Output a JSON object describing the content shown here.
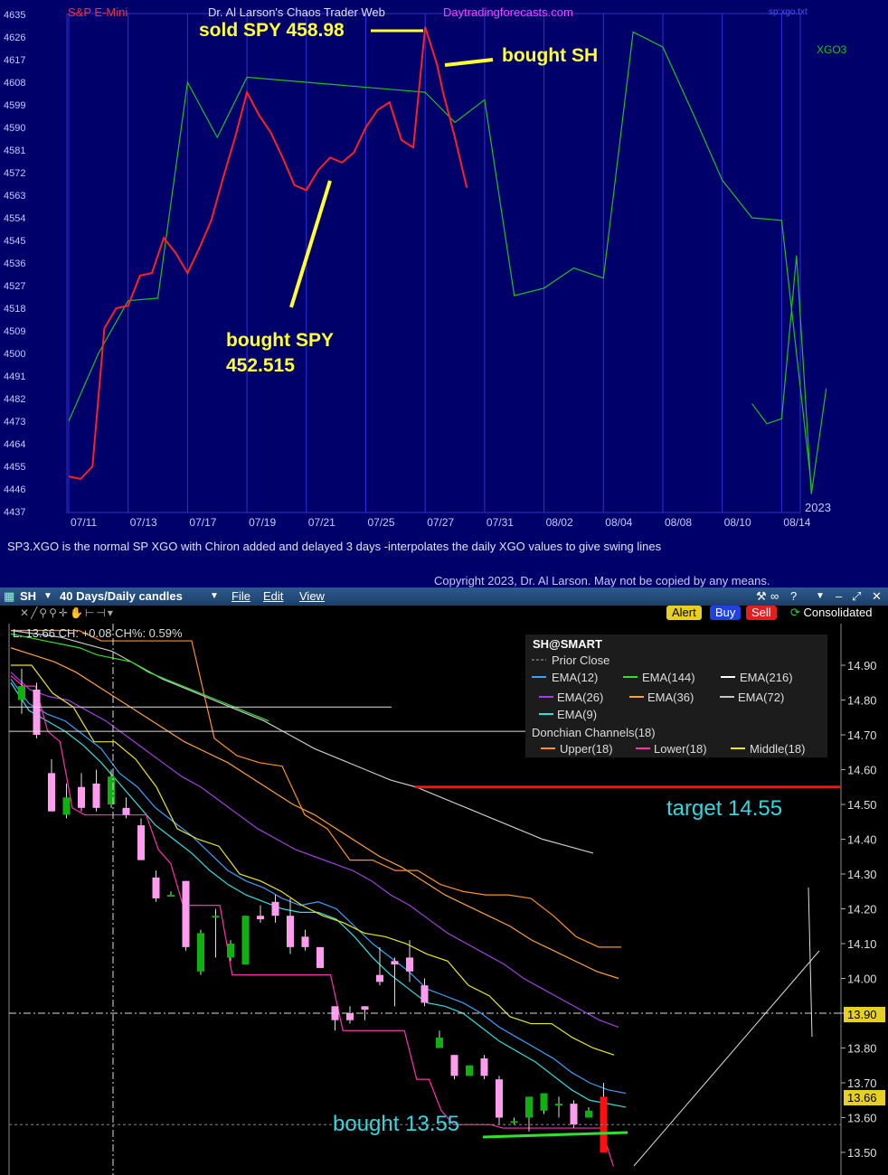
{
  "top_chart": {
    "header": {
      "left": "S&P E-Mini",
      "center": "Dr. Al Larson's Chaos Trader Web",
      "site": "Daytradingforecasts.com",
      "right_small": "sp:xgo.txt",
      "legend": "XGO3",
      "year": "2023"
    },
    "annotations": {
      "sold": "sold SPY 458.98",
      "bought_sh": "bought SH",
      "bought_spy_line1": "bought SPY",
      "bought_spy_line2": "452.515"
    },
    "footer_note": "SP3.XGO is the normal SP XGO with Chiron added and delayed 3 days -interpolates the daily XGO values to give swing lines",
    "copyright": "Copyright 2023, Dr. Al Larson. May not be copied by any means.",
    "colors": {
      "background": "#00006a",
      "grid": "#3030e0",
      "price": "#ff2020",
      "xgo": "#20c020",
      "annotation": "#ffff30"
    },
    "chart_data": {
      "type": "line",
      "ylim": [
        4437,
        4635
      ],
      "y_ticks": [
        "4635",
        "4626",
        "4617",
        "4608",
        "4599",
        "4590",
        "4581",
        "4572",
        "4563",
        "4554",
        "4545",
        "4536",
        "4527",
        "4518",
        "4509",
        "4500",
        "4491",
        "4482",
        "4473",
        "4464",
        "4455",
        "4446",
        "4437"
      ],
      "x_tick_labels": [
        "07/11",
        "07/13",
        "07/17",
        "07/19",
        "07/21",
        "07/25",
        "07/27",
        "07/31",
        "08/02",
        "08/04",
        "08/08",
        "08/10",
        "08/14"
      ],
      "series": [
        {
          "type": "line",
          "x": [
            0,
            0.5,
            1,
            1.5,
            2,
            2.5,
            3,
            3.5,
            4,
            4.5,
            5,
            5.5,
            6,
            6.5,
            7,
            7.5,
            8,
            8.5,
            9,
            9.5,
            10,
            10.5,
            11,
            11.5,
            12,
            12.5
          ],
          "y": [
            4473,
            4500,
            4521,
            4522,
            4608,
            4586,
            4610,
            4609,
            4608,
            4607,
            4606,
            4605,
            4604,
            4592,
            4601,
            4523,
            4526,
            4534,
            4530,
            4628,
            4622,
            4596,
            4569,
            4554,
            4553,
            4447
          ]
        },
        {
          "type": "line",
          "x": [
            11.5,
            11.75,
            12,
            12.25,
            12.5,
            12.75
          ],
          "y": [
            4480,
            4472,
            4474,
            4539,
            4444,
            4486
          ]
        },
        {
          "type": "line",
          "x": [
            0,
            0.2,
            0.4,
            0.6,
            0.8,
            1,
            1.2,
            1.4,
            1.6,
            1.8,
            2,
            2.2,
            2.4,
            2.6,
            2.8,
            3,
            3.2,
            3.4,
            3.6,
            3.8,
            4,
            4.2,
            4.4,
            4.6,
            4.8,
            5,
            5.2,
            5.4,
            5.6,
            5.8,
            6,
            6.2,
            6.3,
            6.5,
            6.7
          ],
          "y": [
            4451,
            4450,
            4455,
            4510,
            4518,
            4519,
            4531,
            4532,
            4546,
            4540,
            4532,
            4542,
            4553,
            4570,
            4586,
            4604,
            4595,
            4588,
            4578,
            4567,
            4565,
            4573,
            4578,
            4576,
            4580,
            4590,
            4597,
            4600,
            4585,
            4582,
            4630,
            4615,
            4604,
            4586,
            4566
          ]
        }
      ]
    }
  },
  "bottom_chart": {
    "toolbar": {
      "symbol": "SH",
      "period": "40 Days/Daily candles",
      "menu": [
        "File",
        "Edit",
        "View"
      ]
    },
    "info_line": "L: 13.66 CH: +0.08 CH%: 0.59%",
    "buttons": {
      "alert": "Alert",
      "buy": "Buy",
      "sell": "Sell",
      "consolidated": "Consolidated"
    },
    "legend": {
      "title": "SH@SMART",
      "prior_close": "Prior Close",
      "ema12": "EMA(12)",
      "ema144": "EMA(144)",
      "ema216": "EMA(216)",
      "ema26": "EMA(26)",
      "ema36": "EMA(36)",
      "ema72": "EMA(72)",
      "ema9": "EMA(9)",
      "donchian": "Donchian Channels(18)",
      "upper": "Upper(18)",
      "lower": "Lower(18)",
      "middle": "Middle(18)"
    },
    "annotations": {
      "target": "target 14.55",
      "bought": "bought 13.55"
    },
    "price_tags": {
      "last": "13.66",
      "level": "13.90"
    },
    "colors": {
      "up": "#10b010",
      "down": "#ff9cf0",
      "ema12": "#3aa0ff",
      "ema144": "#30e030",
      "ema216": "#dddddd",
      "ema26": "#a040e0",
      "ema36": "#ffa040",
      "ema72": "#c8c8c8",
      "ema9": "#30e0e0",
      "upper": "#ff9020",
      "lower": "#ff30b0",
      "middle": "#e8e820",
      "target_line": "#ff1010",
      "annotation": "#30d8e0"
    },
    "chart_data": {
      "type": "candlestick",
      "ylim": [
        13.46,
        15.0
      ],
      "y_ticks": [
        "14.90",
        "14.80",
        "14.70",
        "14.60",
        "14.50",
        "14.40",
        "14.30",
        "14.20",
        "14.10",
        "14.00",
        "13.90",
        "13.80",
        "13.70",
        "13.60",
        "13.50"
      ],
      "candles": [
        {
          "o": 14.8,
          "h": 14.89,
          "l": 14.76,
          "c": 14.84
        },
        {
          "o": 14.83,
          "h": 14.85,
          "l": 14.69,
          "c": 14.7
        },
        {
          "o": 14.59,
          "h": 14.63,
          "l": 14.48,
          "c": 14.48
        },
        {
          "o": 14.47,
          "h": 14.56,
          "l": 14.46,
          "c": 14.52
        },
        {
          "o": 14.55,
          "h": 14.59,
          "l": 14.48,
          "c": 14.49
        },
        {
          "o": 14.56,
          "h": 14.6,
          "l": 14.48,
          "c": 14.49
        },
        {
          "o": 14.5,
          "h": 14.6,
          "l": 14.49,
          "c": 14.58
        },
        {
          "o": 14.49,
          "h": 14.52,
          "l": 14.46,
          "c": 14.47
        },
        {
          "o": 14.44,
          "h": 14.46,
          "l": 14.34,
          "c": 14.34
        },
        {
          "o": 14.29,
          "h": 14.31,
          "l": 14.22,
          "c": 14.23
        },
        {
          "o": 14.24,
          "h": 14.25,
          "l": 14.24,
          "c": 14.24
        },
        {
          "o": 14.28,
          "h": 14.28,
          "l": 14.08,
          "c": 14.09
        },
        {
          "o": 14.02,
          "h": 14.14,
          "l": 14.01,
          "c": 14.13
        },
        {
          "o": 14.18,
          "h": 14.2,
          "l": 14.06,
          "c": 14.18
        },
        {
          "o": 14.06,
          "h": 14.11,
          "l": 14.05,
          "c": 14.1
        },
        {
          "o": 14.04,
          "h": 14.18,
          "l": 14.04,
          "c": 14.18
        },
        {
          "o": 14.18,
          "h": 14.21,
          "l": 14.16,
          "c": 14.17
        },
        {
          "o": 14.22,
          "h": 14.24,
          "l": 14.16,
          "c": 14.18
        },
        {
          "o": 14.18,
          "h": 14.23,
          "l": 14.07,
          "c": 14.09
        },
        {
          "o": 14.12,
          "h": 14.14,
          "l": 14.08,
          "c": 14.09
        },
        {
          "o": 14.09,
          "h": 14.09,
          "l": 14.03,
          "c": 14.03
        },
        {
          "o": 13.92,
          "h": 13.92,
          "l": 13.85,
          "c": 13.88
        },
        {
          "o": 13.9,
          "h": 13.92,
          "l": 13.87,
          "c": 13.88
        },
        {
          "o": 13.92,
          "h": 13.92,
          "l": 13.88,
          "c": 13.91
        },
        {
          "o": 14.01,
          "h": 14.09,
          "l": 13.98,
          "c": 13.99
        },
        {
          "o": 14.05,
          "h": 14.06,
          "l": 13.92,
          "c": 14.04
        },
        {
          "o": 14.06,
          "h": 14.11,
          "l": 13.99,
          "c": 14.02
        },
        {
          "o": 13.98,
          "h": 14.0,
          "l": 13.92,
          "c": 13.93
        },
        {
          "o": 13.8,
          "h": 13.85,
          "l": 13.8,
          "c": 13.83
        },
        {
          "o": 13.78,
          "h": 13.78,
          "l": 13.71,
          "c": 13.72
        },
        {
          "o": 13.72,
          "h": 13.75,
          "l": 13.72,
          "c": 13.75
        },
        {
          "o": 13.77,
          "h": 13.78,
          "l": 13.71,
          "c": 13.72
        },
        {
          "o": 13.71,
          "h": 13.72,
          "l": 13.58,
          "c": 13.6
        },
        {
          "o": 13.59,
          "h": 13.6,
          "l": 13.58,
          "c": 13.59
        },
        {
          "o": 13.6,
          "h": 13.66,
          "l": 13.56,
          "c": 13.66
        },
        {
          "o": 13.62,
          "h": 13.67,
          "l": 13.61,
          "c": 13.67
        },
        {
          "o": 13.64,
          "h": 13.66,
          "l": 13.6,
          "c": 13.64
        },
        {
          "o": 13.64,
          "h": 13.65,
          "l": 13.57,
          "c": 13.58
        },
        {
          "o": 13.6,
          "h": 13.63,
          "l": 13.6,
          "c": 13.62
        },
        {
          "o": 13.66,
          "h": 13.7,
          "l": 13.5,
          "c": 13.5
        }
      ],
      "series": [
        {
          "name": "EMA(12)",
          "values": [
            14.86,
            14.79,
            14.76,
            14.74,
            14.7,
            14.66,
            14.59,
            14.55,
            14.49,
            14.45,
            14.41,
            14.36,
            14.31,
            14.28,
            14.26,
            14.23,
            14.21,
            14.22,
            14.2,
            14.15,
            14.1,
            14.06,
            14.02,
            13.97,
            13.95,
            13.93,
            13.9,
            13.86,
            13.83,
            13.8,
            13.77,
            13.73,
            13.7,
            13.68,
            13.67
          ]
        },
        {
          "name": "EMA(9)",
          "values": [
            14.85,
            14.77,
            14.74,
            14.71,
            14.67,
            14.62,
            14.56,
            14.5,
            14.44,
            14.4,
            14.36,
            14.31,
            14.27,
            14.24,
            14.22,
            14.2,
            14.19,
            14.19,
            14.17,
            14.12,
            14.06,
            14.01,
            13.97,
            13.93,
            13.92,
            13.9,
            13.86,
            13.82,
            13.79,
            13.76,
            13.72,
            13.68,
            13.65,
            13.64,
            13.63
          ]
        },
        {
          "name": "EMA(26)",
          "values": [
            14.88,
            14.83,
            14.81,
            14.8,
            14.77,
            14.74,
            14.7,
            14.66,
            14.62,
            14.58,
            14.55,
            14.51,
            14.47,
            14.43,
            14.4,
            14.37,
            14.35,
            14.33,
            14.31,
            14.28,
            14.24,
            14.21,
            14.17,
            14.13,
            14.1,
            14.07,
            14.04,
            14.0,
            13.97,
            13.94,
            13.91,
            13.88,
            13.86
          ]
        },
        {
          "name": "Middle(18)",
          "values": [
            14.9,
            14.9,
            14.82,
            14.78,
            14.68,
            14.68,
            14.63,
            14.55,
            14.43,
            14.4,
            14.38,
            14.3,
            14.28,
            14.25,
            14.21,
            14.18,
            14.16,
            14.13,
            14.12,
            14.1,
            14.07,
            14.05,
            13.98,
            13.95,
            13.89,
            13.87,
            13.87,
            13.83,
            13.8,
            13.78
          ]
        },
        {
          "name": "EMA(36)",
          "values": [
            14.95,
            14.93,
            14.91,
            14.88,
            14.84,
            14.8,
            14.76,
            14.72,
            14.68,
            14.65,
            14.62,
            14.58,
            14.54,
            14.5,
            14.47,
            14.43,
            14.39,
            14.35,
            14.32,
            14.28,
            14.24,
            14.21,
            14.18,
            14.15,
            14.11,
            14.08,
            14.05,
            14.02,
            14.0
          ]
        },
        {
          "name": "Upper(18)",
          "values": [
            15.0,
            15.0,
            15.0,
            15.0,
            14.97,
            14.97,
            14.97,
            14.97,
            14.97,
            14.69,
            14.64,
            14.62,
            14.61,
            14.47,
            14.43,
            14.34,
            14.34,
            14.31,
            14.31,
            14.27,
            14.25,
            14.24,
            14.24,
            14.23,
            14.18,
            14.12,
            14.09,
            14.09
          ]
        },
        {
          "name": "EMA(72)",
          "values": [
            15.0,
            14.99,
            14.98,
            14.96,
            14.94,
            14.9,
            14.86,
            14.83,
            14.8,
            14.77,
            14.74,
            14.7,
            14.66,
            14.63,
            14.6,
            14.57,
            14.55,
            14.52,
            14.49,
            14.46,
            14.43,
            14.4,
            14.38,
            14.36
          ]
        },
        {
          "name": "EMA(144)",
          "values": [
            14.99,
            14.98,
            14.97,
            14.96,
            14.95,
            14.93,
            14.92,
            14.91,
            14.88,
            14.86,
            14.84,
            14.82,
            14.8,
            14.78,
            14.76,
            14.74
          ]
        },
        {
          "name": "Lower(18)",
          "values": [
            14.87,
            14.84,
            14.84,
            14.71,
            14.68,
            14.49,
            14.47,
            14.47,
            14.47,
            14.47,
            14.47,
            14.47,
            14.37,
            14.33,
            14.21,
            14.21,
            14.21,
            14.21,
            14.01,
            14.01,
            14.01,
            14.01,
            14.01,
            14.01,
            14.01,
            14.01,
            14.01,
            13.85,
            13.85,
            13.85,
            13.85,
            13.85,
            13.85,
            13.71,
            13.71,
            13.62,
            13.58,
            13.58,
            13.58,
            13.58,
            13.57,
            13.57,
            13.57,
            13.57,
            13.57,
            13.57,
            13.57,
            13.57,
            13.57,
            13.46
          ]
        }
      ],
      "reference_lines": {
        "target": 14.55,
        "level": 13.9,
        "prior_close": 13.58,
        "white_top": 14.78,
        "white_second": 14.71
      }
    }
  }
}
